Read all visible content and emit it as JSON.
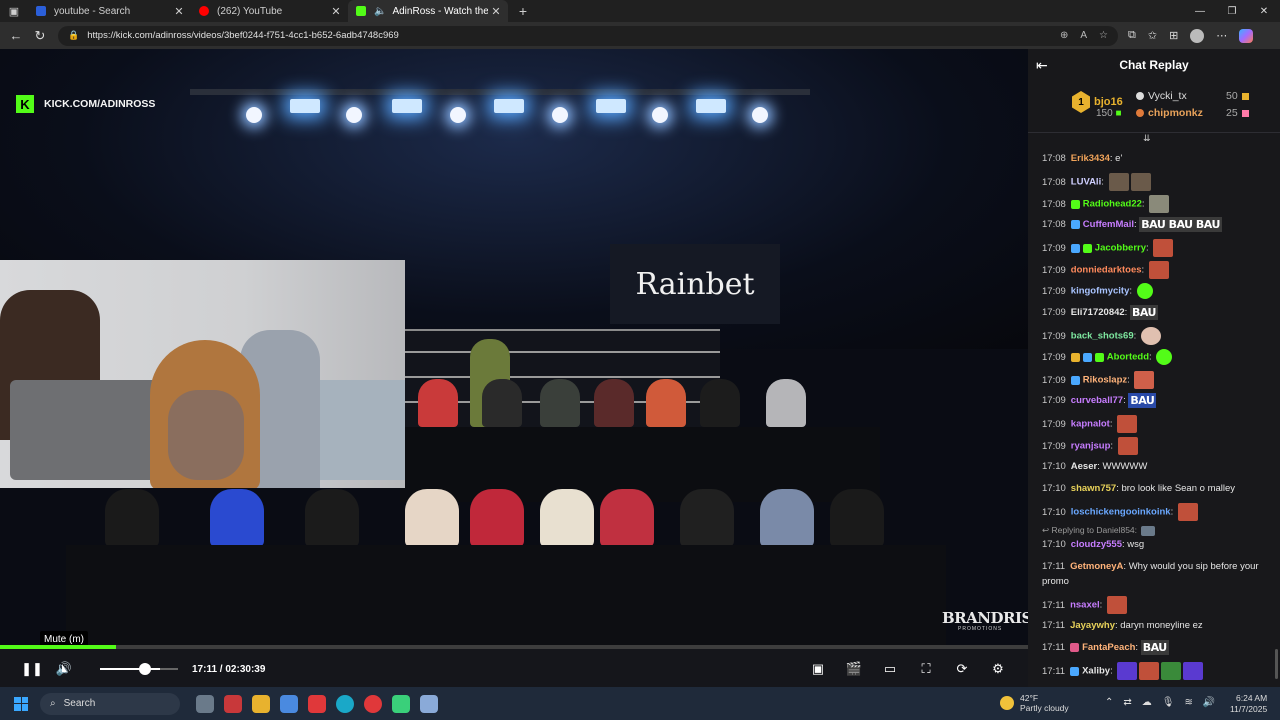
{
  "browser": {
    "tabs": [
      {
        "title": "youtube - Search",
        "favicon_color": "#2b5fd9"
      },
      {
        "title": "(262) YouTube",
        "favicon_color": "#ff0000"
      },
      {
        "title": "AdinRoss - Watch the VOD o",
        "favicon_color": "#53fc18"
      }
    ],
    "url": "https://kick.com/adinross/videos/3bef0244-f751-4cc1-b652-6adb4748c969"
  },
  "video": {
    "watermark": "KICK.COM/ADINROSS",
    "sponsor": "Rainbet",
    "brand": "BRANDRISK",
    "brand_sub": "PROMOTIONS",
    "tooltip": "Mute (m)",
    "progress": 0.113,
    "volume": 0.75,
    "current_time": "17:11",
    "total_time": "02:30:39"
  },
  "chat": {
    "title": "Chat Replay",
    "gifters": {
      "top": {
        "rank": "1",
        "name": "bjo16",
        "count": "150"
      },
      "second": {
        "name": "Vycki_tx",
        "count": "50"
      },
      "third": {
        "name": "chipmonkz",
        "count": "25"
      }
    },
    "messages": [
      {
        "time": "17:08",
        "user": "Erik3434",
        "color": "#f0a35a",
        "text": "e'"
      },
      {
        "time": "17:08",
        "user": "LUVAli",
        "color": "#cfcfff",
        "text": ""
      },
      {
        "time": "17:08",
        "user": "Radiohead22",
        "color": "#53fc18",
        "text": ""
      },
      {
        "time": "17:08",
        "user": "CuffemMail",
        "color": "#c77dff",
        "text": "BAU BAU BAU"
      },
      {
        "time": "17:09",
        "user": "Jacobberry",
        "color": "#53fc18",
        "text": ""
      },
      {
        "time": "17:09",
        "user": "donniedarktoes",
        "color": "#ff8a5c",
        "text": ""
      },
      {
        "time": "17:09",
        "user": "kingofmycity",
        "color": "#a9c4ff",
        "text": ""
      },
      {
        "time": "17:09",
        "user": "Eli71720842",
        "color": "#e5e5e5",
        "text": "BAU"
      },
      {
        "time": "17:09",
        "user": "back_shots69",
        "color": "#7ee8a0",
        "text": ""
      },
      {
        "time": "17:09",
        "user": "Abortedd",
        "color": "#53fc18",
        "text": ""
      },
      {
        "time": "17:09",
        "user": "Rikoslapz",
        "color": "#ffb37a",
        "text": ""
      },
      {
        "time": "17:09",
        "user": "curveball77",
        "color": "#c77dff",
        "text": "BAU"
      },
      {
        "time": "17:09",
        "user": "kapnalot",
        "color": "#c77dff",
        "text": ""
      },
      {
        "time": "17:09",
        "user": "ryanjsup",
        "color": "#c77dff",
        "text": ""
      },
      {
        "time": "17:10",
        "user": "Aeser",
        "color": "#e5e5e5",
        "text": "WWWWW"
      },
      {
        "time": "17:10",
        "user": "shawn757",
        "color": "#e8d25a",
        "text": "bro look like Sean o malley"
      },
      {
        "time": "17:10",
        "user": "loschickengooinkoink",
        "color": "#6aa8ff",
        "text": ""
      },
      {
        "time": "17:10",
        "user": "cloudzy555",
        "color": "#c77dff",
        "text": "wsg"
      },
      {
        "time": "17:11",
        "user": "GetmoneyA",
        "color": "#ffb37a",
        "text": "Why would you sip before your promo"
      },
      {
        "time": "17:11",
        "user": "nsaxel",
        "color": "#c77dff",
        "text": ""
      },
      {
        "time": "17:11",
        "user": "Jayaywhy",
        "color": "#e8d25a",
        "text": "daryn moneyline ez"
      },
      {
        "time": "17:11",
        "user": "FantaPeach",
        "color": "#ffb37a",
        "text": "BAU"
      },
      {
        "time": "17:11",
        "user": "Xaliby",
        "color": "#e5e5e5",
        "text": ""
      }
    ],
    "reply_to": "Replying to Daniel854:"
  },
  "taskbar": {
    "search": "Search",
    "weather_temp": "42°F",
    "weather_desc": "Partly cloudy",
    "time": "6:24 AM",
    "date": "11/7/2025"
  }
}
